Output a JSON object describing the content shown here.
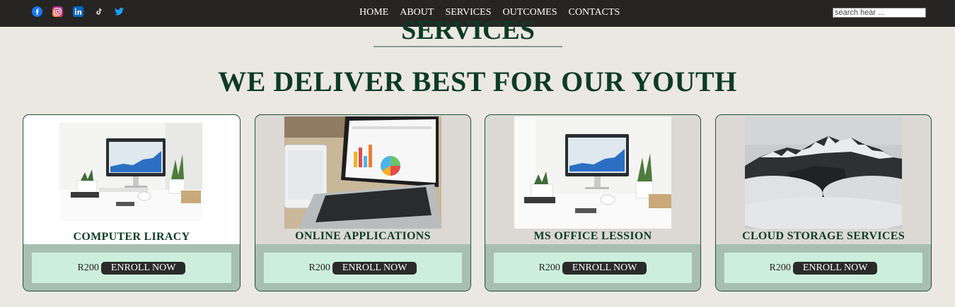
{
  "header": {
    "social": [
      "facebook-icon",
      "instagram-icon",
      "linkedin-icon",
      "tiktok-icon",
      "twitter-icon"
    ],
    "nav": [
      "HOME",
      "ABOUT",
      "SERVICES",
      "OUTCOMES",
      "CONTACTS"
    ],
    "search_placeholder": "search hear ..."
  },
  "section": {
    "title": "SERVICES",
    "headline": "WE DELIVER BEST FOR OUR YOUTH"
  },
  "cards": [
    {
      "title": "COMPUTER LIRACY",
      "price": "R200",
      "button": "ENROLL NOW",
      "image": "desk-computer-image"
    },
    {
      "title": "ONLINE APPLICATIONS",
      "price": "R200",
      "button": "ENROLL NOW",
      "image": "laptop-charts-image"
    },
    {
      "title": "MS OFFICE LESSION",
      "price": "R200",
      "button": "ENROLL NOW",
      "image": "desk-computer-image"
    },
    {
      "title": "CLOUD STORAGE SERVICES",
      "price": "R200",
      "button": "ENROLL NOW",
      "image": "misty-mountain-image"
    }
  ],
  "colors": {
    "topbar": "#262524",
    "page_bg": "#ebe8e1",
    "heading": "#0d3b28",
    "card_footer": "#a8bfb0",
    "card_footer_inner": "#cdeedd",
    "button_bg": "#2a2a2a"
  }
}
